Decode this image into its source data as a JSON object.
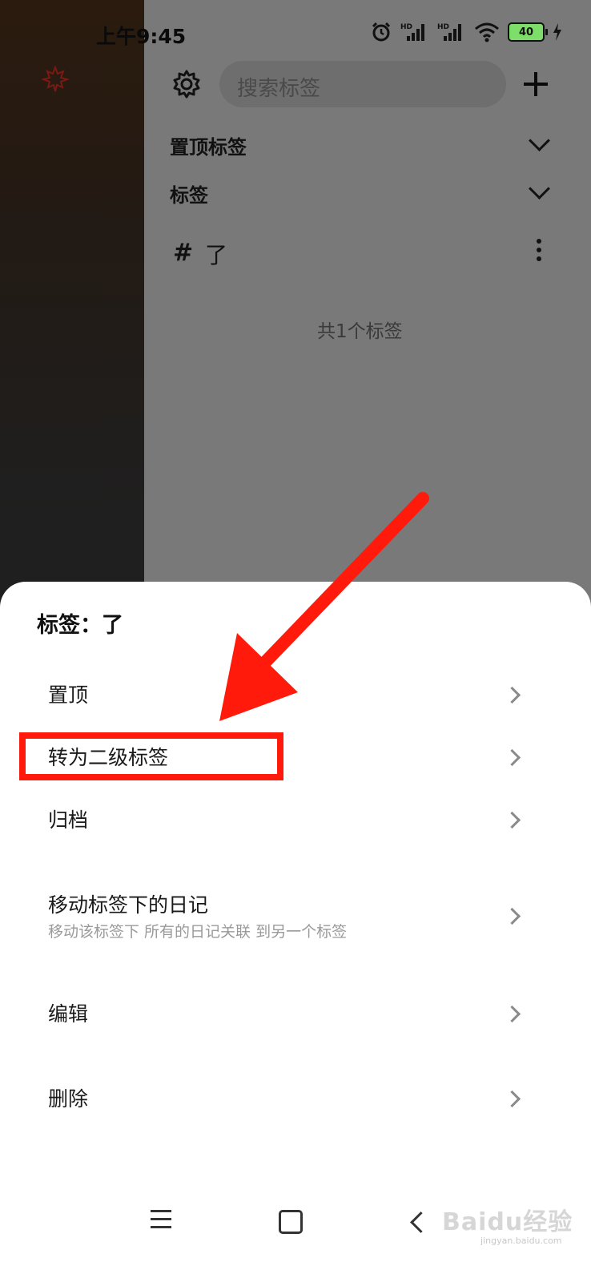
{
  "status_bar": {
    "time": "上午9:45",
    "battery": "40",
    "accent": "#7ddf6a"
  },
  "sidebar": {
    "logo_icon": "maple-leaf-icon"
  },
  "header": {
    "settings_icon": "gear-icon",
    "search_placeholder": "搜索标签",
    "add_icon": "plus-icon"
  },
  "sections": [
    {
      "label": "置顶标签"
    },
    {
      "label": "标签"
    }
  ],
  "tag_list": {
    "items": [
      {
        "symbol": "#",
        "name": "了"
      }
    ],
    "count_text": "共1个标签"
  },
  "sheet": {
    "title": "标签：了",
    "options": [
      {
        "label": "置顶"
      },
      {
        "label": "转为二级标签"
      },
      {
        "label": "归档"
      },
      {
        "label": "移动标签下的日记",
        "sub": "移动该标签下 所有的日记关联 到另一个标签"
      },
      {
        "label": "编辑"
      },
      {
        "label": "删除"
      }
    ]
  },
  "annotation": {
    "color": "#ff1a0c"
  },
  "nav_bar": {
    "icons": [
      "menu-icon",
      "home-icon",
      "back-icon"
    ]
  },
  "watermark": {
    "text": "Baidu经验",
    "sub": "jingyan.baidu.com"
  }
}
